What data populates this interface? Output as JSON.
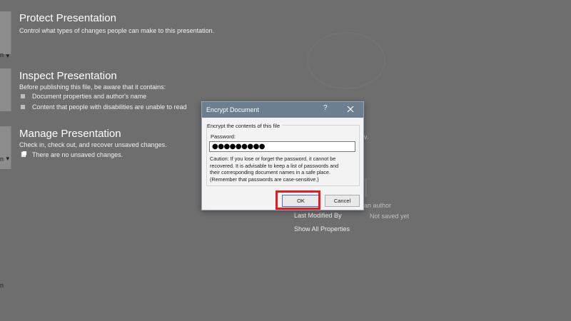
{
  "sections": {
    "protect": {
      "title": "Protect Presentation",
      "description": "Control what types of changes people can make to this presentation."
    },
    "inspect": {
      "title": "Inspect Presentation",
      "description": "Before publishing this file, be aware that it contains:",
      "items": [
        "Document properties and author's name",
        "Content that people with disabilities are unable to read"
      ]
    },
    "manage": {
      "title": "Manage Presentation",
      "description": "Check in, check out, and recover unsaved changes.",
      "note": "There are no unsaved changes."
    }
  },
  "side_buttons": {
    "protect_label": "n",
    "manage_label": "n"
  },
  "properties": {
    "partial_fragment_1": "v.",
    "author_placeholder": "an author",
    "last_modified_by_label": "Last Modified By",
    "last_modified_by_value": "Not saved yet",
    "show_all_link": "Show All Properties"
  },
  "dialog": {
    "title": "Encrypt Document",
    "help_glyph": "?",
    "group_label": "Encrypt the contents of this file",
    "password_label": "Password:",
    "password_value": "●●●●●●●●●",
    "caution_lines": [
      "Caution: If you lose or forget the password, it cannot be",
      "recovered. It is advisable to keep a list of passwords and",
      "their corresponding document names in a safe place.",
      "(Remember that passwords are case-sensitive.)"
    ],
    "ok_label": "OK",
    "cancel_label": "Cancel"
  },
  "colors": {
    "backdrop": "#6e6e6e",
    "dialog_titlebar": "#6b7f91",
    "highlight": "#e41b23"
  }
}
